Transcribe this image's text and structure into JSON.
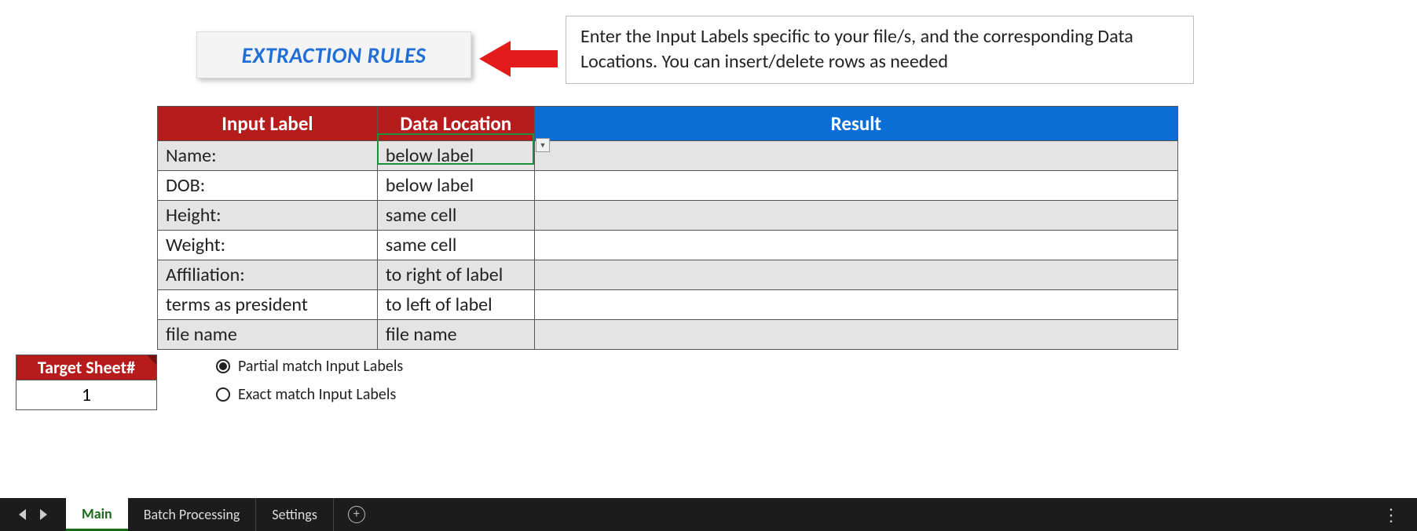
{
  "title": "EXTRACTION RULES",
  "help_text": "Enter the Input Labels specific to your file/s, and the corresponding Data Locations. You can insert/delete rows as needed",
  "table": {
    "headers": {
      "input_label": "Input Label",
      "data_location": "Data Location",
      "result": "Result"
    },
    "rows": [
      {
        "input_label": "Name:",
        "data_location": "below label",
        "result": ""
      },
      {
        "input_label": "DOB:",
        "data_location": "below label",
        "result": ""
      },
      {
        "input_label": "Height:",
        "data_location": "same cell",
        "result": ""
      },
      {
        "input_label": "Weight:",
        "data_location": "same cell",
        "result": ""
      },
      {
        "input_label": "Affiliation:",
        "data_location": "to right of label",
        "result": ""
      },
      {
        "input_label": "terms as president",
        "data_location": "to left of label",
        "result": ""
      },
      {
        "input_label": "file name",
        "data_location": "file name",
        "result": ""
      }
    ]
  },
  "target_sheet": {
    "header": "Target Sheet#",
    "value": "1"
  },
  "match_options": {
    "partial": "Partial match Input Labels",
    "exact": "Exact match Input Labels",
    "selected": "partial"
  },
  "tabs": {
    "items": [
      {
        "label": "Main",
        "active": true
      },
      {
        "label": "Batch Processing",
        "active": false
      },
      {
        "label": "Settings",
        "active": false
      }
    ]
  },
  "colors": {
    "header_red": "#b71c1c",
    "header_blue": "#0a6ed6",
    "title_blue": "#1f6fd6",
    "tab_active_green": "#1a6a1a"
  }
}
